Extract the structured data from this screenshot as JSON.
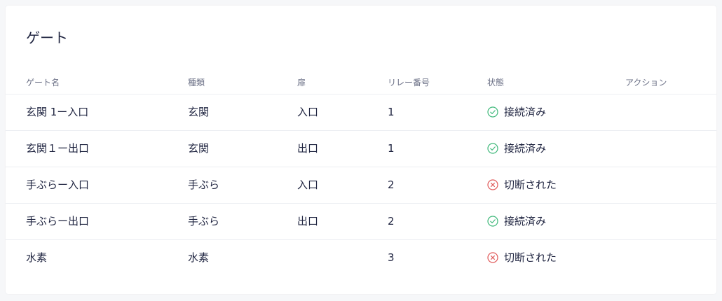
{
  "page": {
    "title": "ゲート"
  },
  "table": {
    "headers": {
      "name": "ゲート名",
      "type": "種類",
      "door": "扉",
      "relay": "リレー番号",
      "status": "状態",
      "action": "アクション"
    },
    "rows": [
      {
        "name": "玄関 1ー入口",
        "type": "玄関",
        "door": "入口",
        "relay": "1",
        "status": "接続済み",
        "status_kind": "connected"
      },
      {
        "name": "玄関１ー出口",
        "type": "玄関",
        "door": "出口",
        "relay": "1",
        "status": "接続済み",
        "status_kind": "connected"
      },
      {
        "name": "手ぶらー入口",
        "type": "手ぶら",
        "door": "入口",
        "relay": "2",
        "status": "切断された",
        "status_kind": "disconnected"
      },
      {
        "name": "手ぶらー出口",
        "type": "手ぶら",
        "door": "出口",
        "relay": "2",
        "status": "接続済み",
        "status_kind": "connected"
      },
      {
        "name": "水素",
        "type": "水素",
        "door": "",
        "relay": "3",
        "status": "切断された",
        "status_kind": "disconnected"
      }
    ]
  },
  "icons": {
    "connected": "check-circle-icon",
    "disconnected": "x-circle-icon"
  },
  "colors": {
    "connected": "#3fb87a",
    "disconnected": "#e05a5a"
  }
}
